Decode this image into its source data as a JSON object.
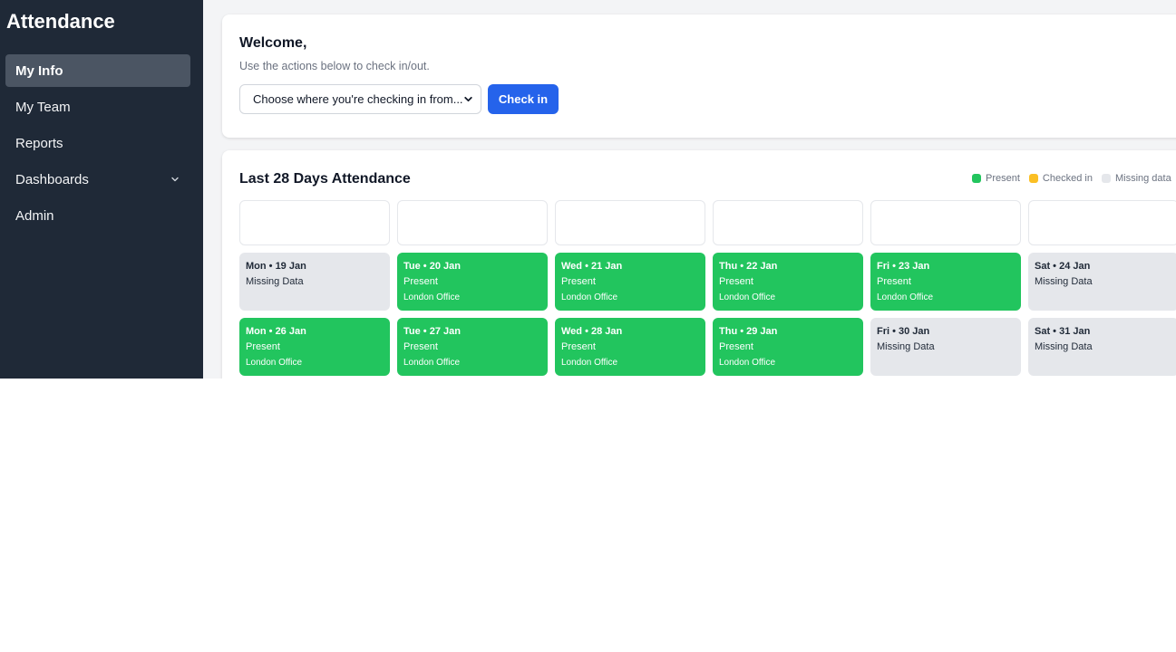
{
  "app": {
    "title": "Attendance"
  },
  "sidebar": {
    "items": [
      {
        "label": "My Info",
        "active": true
      },
      {
        "label": "My Team"
      },
      {
        "label": "Reports"
      },
      {
        "label": "Dashboards",
        "icon": "chevron-down-icon"
      },
      {
        "label": "Admin"
      }
    ]
  },
  "welcome": {
    "title": "Welcome,",
    "subtitle": "Use the actions below to check in/out.",
    "location_select": {
      "value": "Choose where you're checking in from..."
    },
    "checkin_label": "Check in"
  },
  "attendance": {
    "title": "Last 28 Days Attendance",
    "legend": [
      {
        "label": "Present",
        "color": "#22c55e"
      },
      {
        "label": "Checked in",
        "color": "#fbbf24"
      },
      {
        "label": "Missing data",
        "color": "#e5e7eb"
      }
    ],
    "week1": [
      {
        "date": "Mon • 19 Jan",
        "status": "Missing Data",
        "location": ""
      },
      {
        "date": "Tue • 20 Jan",
        "status": "Present",
        "location": "London Office"
      },
      {
        "date": "Wed • 21 Jan",
        "status": "Present",
        "location": "London Office"
      },
      {
        "date": "Thu • 22 Jan",
        "status": "Present",
        "location": "London Office"
      },
      {
        "date": "Fri • 23 Jan",
        "status": "Present",
        "location": "London Office"
      },
      {
        "date": "Sat • 24 Jan",
        "status": "Missing Data",
        "location": ""
      }
    ],
    "week2": [
      {
        "date": "Mon • 26 Jan",
        "status": "Present",
        "location": "London Office"
      },
      {
        "date": "Tue • 27 Jan",
        "status": "Present",
        "location": "London Office"
      },
      {
        "date": "Wed • 28 Jan",
        "status": "Present",
        "location": "London Office"
      },
      {
        "date": "Thu • 29 Jan",
        "status": "Present",
        "location": "London Office"
      },
      {
        "date": "Fri • 30 Jan",
        "status": "Missing Data",
        "location": ""
      },
      {
        "date": "Sat • 31 Jan",
        "status": "Missing Data",
        "location": ""
      }
    ]
  }
}
